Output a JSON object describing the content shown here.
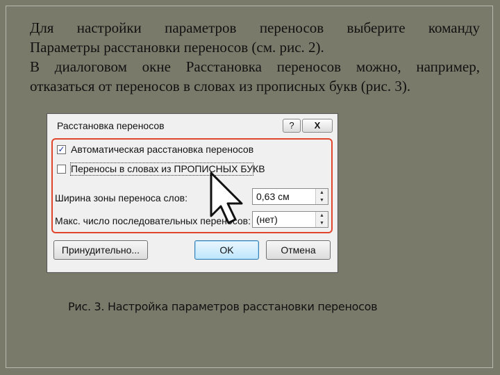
{
  "body_text": {
    "line1": "Для настройки параметров переносов выберите команду",
    "line2": "Параметры расстановки переносов (см. рис. 2).",
    "line3": "В диалоговом окне Расстановка переносов можно, например,",
    "line4": "отказаться от переносов в словах из прописных букв (рис. 3)."
  },
  "dialog": {
    "title": "Расстановка переносов",
    "help_label": "?",
    "close_label": "X",
    "auto_hyphenation": {
      "label": "Автоматическая расстановка переносов",
      "checked": true,
      "mark": "✓"
    },
    "caps_hyphenation": {
      "label": "Переносы в словах из ПРОПИСНЫХ БУКВ",
      "checked": false
    },
    "zone_width": {
      "label": "Ширина зоны переноса слов:",
      "value": "0,63 см"
    },
    "max_consecutive": {
      "label": "Макс. число последовательных переносов:",
      "value": "(нет)"
    },
    "spin_up": "▲",
    "spin_down": "▼",
    "buttons": {
      "force": "Принудительно...",
      "ok": "OK",
      "cancel": "Отмена"
    }
  },
  "caption": "Рис. 3. Настройка параметров расстановки переносов",
  "colors": {
    "background": "#7a7a6b",
    "highlight": "#e0452b"
  }
}
